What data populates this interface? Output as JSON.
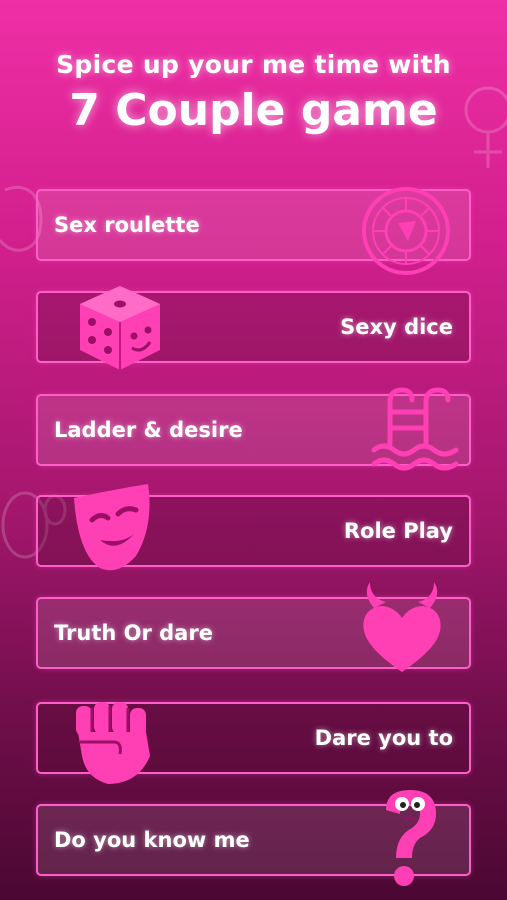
{
  "header": {
    "subtitle": "Spice up your me time with",
    "title": "7 Couple game"
  },
  "games": [
    {
      "label": "Sex roulette",
      "icon": "roulette-icon"
    },
    {
      "label": "Sexy dice",
      "icon": "dice-icon"
    },
    {
      "label": "Ladder & desire",
      "icon": "pool-ladder-icon"
    },
    {
      "label": "Role Play",
      "icon": "theater-mask-icon"
    },
    {
      "label": "Truth Or dare",
      "icon": "devil-heart-icon"
    },
    {
      "label": "Dare you to",
      "icon": "fist-icon"
    },
    {
      "label": "Do you know me",
      "icon": "question-mark-icon"
    }
  ],
  "colors": {
    "accent": "#ff3fb4",
    "border": "#ff5ec8",
    "text": "#ffffff"
  }
}
